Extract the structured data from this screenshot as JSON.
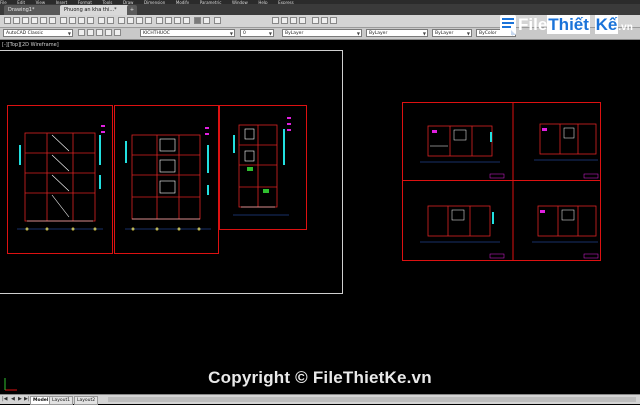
{
  "menu": [
    "File",
    "Edit",
    "View",
    "Insert",
    "Format",
    "Tools",
    "Draw",
    "Dimension",
    "Modify",
    "Parametric",
    "Window",
    "Help",
    "Express"
  ],
  "tabs": [
    "Drawing1*",
    "Phuong an kha thi...*",
    "+"
  ],
  "toolbar": {
    "workspace": "AutoCAD Classic",
    "dimstyle": "KICHTHUOC",
    "layer": "0",
    "color": "ByLayer",
    "linetype": "ByLayer",
    "lineweight": "ByLayer",
    "plotstyle": "ByColor"
  },
  "viewport_label": "[-][Top][2D Wireframe]",
  "watermark_logo": {
    "file": "File",
    "thiet": "Thiết",
    "ke": "Kế",
    "vn": ".vn"
  },
  "watermark": "Copyright © FileThietKe.vn",
  "layout_tabs": [
    "Model",
    "Layout1",
    "Layout2"
  ],
  "colors": {
    "frame": "#dd1111",
    "canvas": "#000000",
    "accent_cyan": "#22e0e0",
    "accent_magenta": "#e020e0",
    "logo_blue": "#1a73d9"
  }
}
